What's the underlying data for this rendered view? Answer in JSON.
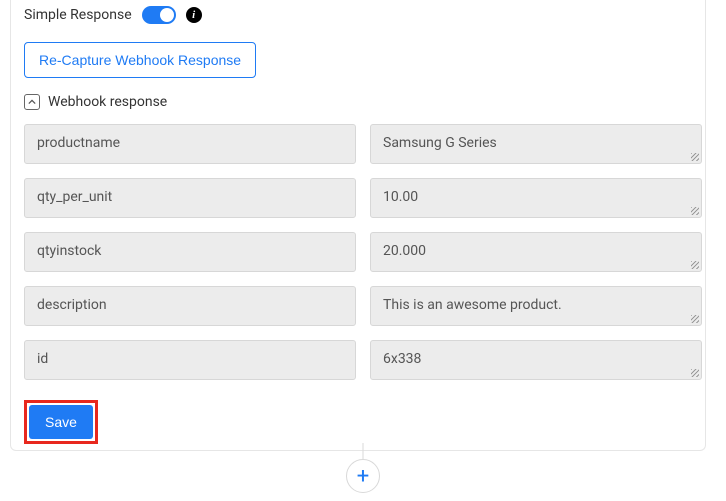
{
  "header": {
    "title": "Simple Response"
  },
  "recapture_label": "Re-Capture Webhook Response",
  "section_title": "Webhook response",
  "fields": [
    {
      "key": "productname",
      "value": "Samsung G Series"
    },
    {
      "key": "qty_per_unit",
      "value": "10.00"
    },
    {
      "key": "qtyinstock",
      "value": "20.000"
    },
    {
      "key": "description",
      "value": "This is an awesome product."
    },
    {
      "key": "id",
      "value": "6x338"
    }
  ],
  "save_label": "Save",
  "plus_label": "+"
}
